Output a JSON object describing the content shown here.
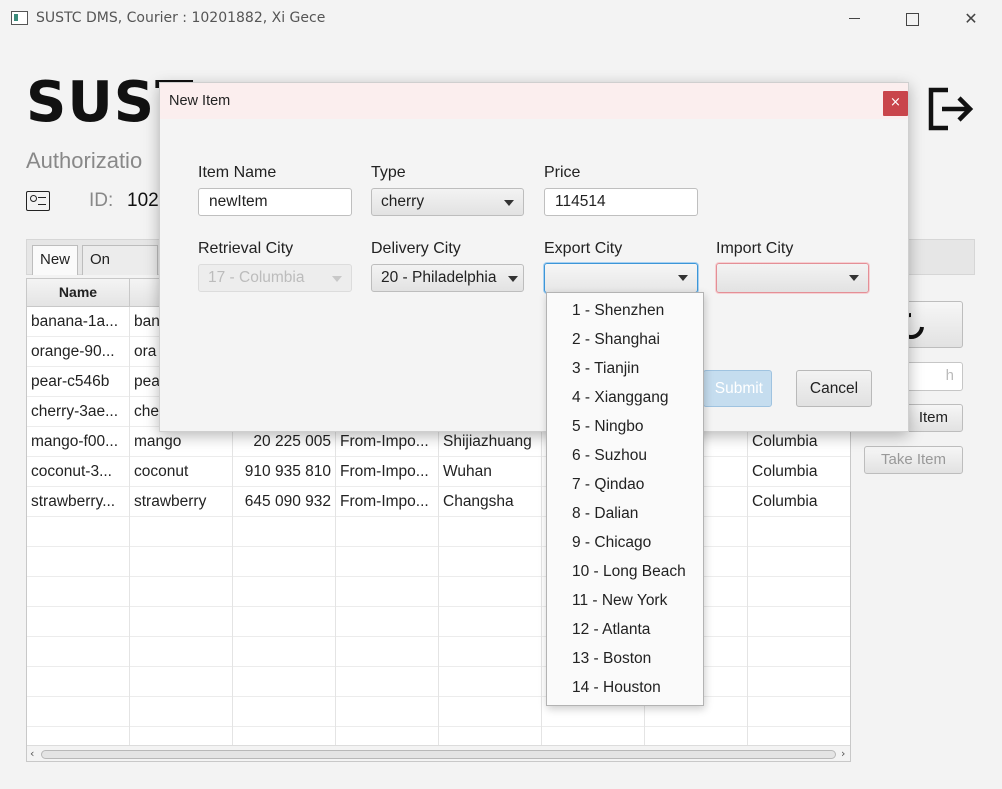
{
  "window": {
    "title": "SUSTC DMS, Courier : 10201882, Xi Gece"
  },
  "header": {
    "brand": "SUST",
    "authorization": "Authorizatio",
    "id_label": "ID:",
    "id_value": "102"
  },
  "tabs": [
    {
      "label": "New",
      "active": true
    },
    {
      "label": "On going",
      "active": false
    }
  ],
  "table": {
    "name_header": "Name",
    "rows": [
      [
        "banana-1a...",
        "ban",
        "",
        "",
        "",
        "",
        "",
        ""
      ],
      [
        "orange-90...",
        "ora",
        "",
        "",
        "",
        "",
        "",
        ""
      ],
      [
        "pear-c546b",
        "pea",
        "",
        "",
        "",
        "",
        "",
        ""
      ],
      [
        "cherry-3ae...",
        "che",
        "",
        "",
        "",
        "",
        "",
        ""
      ],
      [
        "mango-f00...",
        "mango",
        "20 225 005",
        "From-Impo...",
        "Shijiazhuang",
        "",
        "each",
        "Columbia"
      ],
      [
        "coconut-3...",
        "coconut",
        "910 935 810",
        "From-Impo...",
        "Wuhan",
        "",
        "ork",
        "Columbia"
      ],
      [
        "strawberry...",
        "strawberry",
        "645 090 932",
        "From-Impo...",
        "Changsha",
        "",
        "",
        "Columbia"
      ]
    ]
  },
  "side": {
    "search_placeholder": "h",
    "new_item": "Item",
    "take_item": "Take Item"
  },
  "dialog": {
    "title": "New Item",
    "close": "×",
    "item_name_label": "Item Name",
    "item_name_value": "newItem",
    "type_label": "Type",
    "type_value": "cherry",
    "price_label": "Price",
    "price_value": "114514",
    "retrieval_city_label": "Retrieval City",
    "retrieval_city_value": "17 - Columbia",
    "delivery_city_label": "Delivery City",
    "delivery_city_value": "20 - Philadelphia",
    "export_city_label": "Export City",
    "export_city_value": "",
    "import_city_label": "Import City",
    "import_city_value": "",
    "submit": "Submit",
    "cancel": "Cancel"
  },
  "export_city_options": [
    "1 - Shenzhen",
    "2 - Shanghai",
    "3 - Tianjin",
    "4 - Xianggang",
    "5 - Ningbo",
    "6 - Suzhou",
    "7 - Qindao",
    "8 - Dalian",
    "9 - Chicago",
    "10 - Long Beach",
    "11 - New York",
    "12 - Atlanta",
    "13 - Boston",
    "14 - Houston"
  ],
  "colors": {
    "dialog_title_bg": "#fbeeee",
    "close_red": "#c9454b",
    "focus_blue": "#3c96d8",
    "error_pink": "#e48f96",
    "submit_disabled": "#c5ddef"
  }
}
